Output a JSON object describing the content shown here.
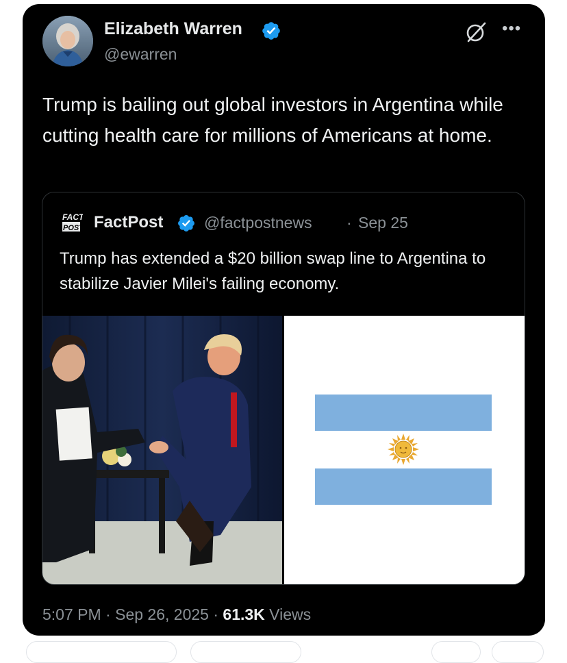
{
  "tweet": {
    "author": {
      "name": "Elizabeth Warren",
      "handle": "@ewarren",
      "verified": true
    },
    "text": "Trump is bailing out global investors in Argentina while cutting health care for millions of Americans at home.",
    "icons": [
      "grok-icon",
      "more-options-icon",
      "verified-badge-icon"
    ],
    "quote": {
      "logo_text": [
        "FACT",
        "POST"
      ],
      "name": "FactPost",
      "handle": "@factpostnews",
      "separator": "·",
      "date": "Sep 25",
      "verified": true,
      "text": "Trump has extended a $20 billion swap line to Argentina to stabilize Javier Milei's failing economy.",
      "images": [
        "handshake-photo",
        "argentina-flag"
      ]
    },
    "meta": {
      "time": "5:07 PM",
      "separator": "·",
      "date": "Sep 26, 2025",
      "views_count": "61.3K",
      "views_label": "Views"
    }
  },
  "colors": {
    "background": "#000000",
    "text": "#e7e9ea",
    "secondary_text": "#8b9196",
    "verified_blue": "#1d9bf0",
    "flag_blue": "#7fb0de",
    "sun_gold": "#f0b93a"
  }
}
